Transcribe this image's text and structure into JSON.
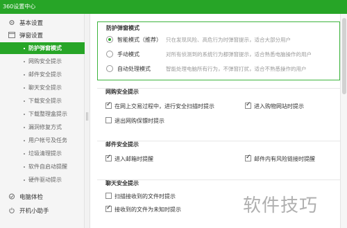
{
  "window": {
    "title": "360设置中心"
  },
  "sidebar": {
    "categories": [
      {
        "label": "基本设置"
      },
      {
        "label": "弹窗设置"
      },
      {
        "label": "电脑体检"
      },
      {
        "label": "开机小助手"
      }
    ],
    "items": [
      {
        "label": "防护弹窗模式"
      },
      {
        "label": "网购安全提示"
      },
      {
        "label": "邮件安全提示"
      },
      {
        "label": "聊天安全提示"
      },
      {
        "label": "下载安全提示"
      },
      {
        "label": "下载整理盒提示"
      },
      {
        "label": "漏洞修复方式"
      },
      {
        "label": "用户帐号及任务"
      },
      {
        "label": "垃圾清理提示"
      },
      {
        "label": "软件自启动提醒"
      },
      {
        "label": "硬件驱动提示"
      }
    ]
  },
  "protection_mode": {
    "title": "防护弹窗模式",
    "options": [
      {
        "name": "智能模式（推荐）",
        "desc": "只在发现风险、高危行为时弹窗提示，适合大部分用户"
      },
      {
        "name": "手动模式",
        "desc": "对所有侦测到的系统行为都弹窗提示，适合熟悉电脑操作的用户"
      },
      {
        "name": "自动处理模式",
        "desc": "智能处理电脑所有行为，不弹窗打扰，适合不熟悉操作的用户"
      }
    ]
  },
  "shopping_safety": {
    "title": "网购安全提示",
    "options": [
      {
        "label": "在网上交易过程中，进行安全扫描时提示"
      },
      {
        "label": "进入购物网站时提示"
      },
      {
        "label": "退出网购保镖时提示"
      }
    ]
  },
  "mail_safety": {
    "title": "邮件安全提示",
    "options": [
      {
        "label": "进入邮箱时提醒"
      },
      {
        "label": "邮件内有风险链接时提醒"
      }
    ]
  },
  "chat_safety": {
    "title": "聊天安全提示",
    "options": [
      {
        "label": "扫描接收到的文件时提示"
      },
      {
        "label": "接收到的文件为未知时提示"
      }
    ]
  },
  "watermark": {
    "text": "软件技巧"
  }
}
